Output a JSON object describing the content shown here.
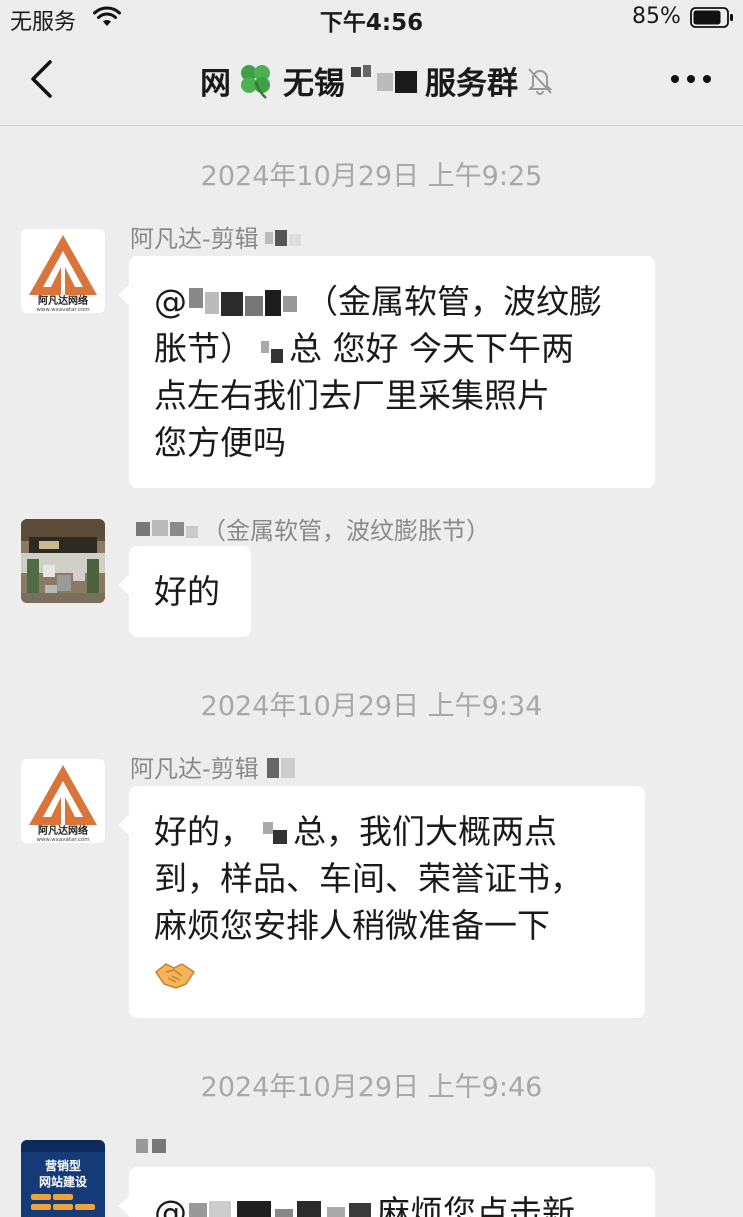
{
  "status_bar": {
    "carrier": "无服务",
    "time": "下午4:56",
    "battery": "85%",
    "icons": [
      "wifi-icon",
      "battery-icon"
    ]
  },
  "nav": {
    "back_icon": "chevron-left-icon",
    "title_prefix": "网",
    "title_emoji": "clover-icon",
    "title_mid": "无锡",
    "title_suffix": "服务群",
    "mute_icon": "bell-muted-icon",
    "more_icon": "more-dots-icon"
  },
  "colors": {
    "background": "#ededed",
    "bubble": "#ffffff",
    "timestamp": "#a8a8a8",
    "sender": "#8a8a8a",
    "avatar_brand": "#d9743a"
  },
  "messages": [
    {
      "type": "timestamp",
      "text": "2024年10月29日 上午9:25"
    },
    {
      "type": "message",
      "sender": "阿凡达-剪辑",
      "avatar": "avatar-brand-logo",
      "avatar_caption": "阿凡达网络",
      "avatar_url": "www.wxavatar.com",
      "text_lead": "@",
      "text_after_mention": "（金属软管，波纹膨",
      "text_line2": "胀节）",
      "text_line2_end": "总 您好 今天下午两",
      "text_line3": "点左右我们去厂里采集照片",
      "text_line4": "您方便吗"
    },
    {
      "type": "message",
      "sender_suffix": "（金属软管，波纹膨胀节）",
      "avatar": "avatar-photo",
      "text": "好的"
    },
    {
      "type": "timestamp",
      "text": "2024年10月29日 上午9:34"
    },
    {
      "type": "message",
      "sender": "阿凡达-剪辑",
      "avatar": "avatar-brand-logo",
      "avatar_caption": "阿凡达网络",
      "avatar_url": "www.wxavatar.com",
      "text_line1_a": "好的，",
      "text_line1_b": "总，我们大概两点",
      "text_line2": "到，样品、车间、荣誉证书，",
      "text_line3": "麻烦您安排人稍微准备一下",
      "emoji": "handshake-icon"
    },
    {
      "type": "timestamp",
      "text": "2024年10月29日 上午9:46"
    },
    {
      "type": "message",
      "avatar": "avatar-website-banner",
      "avatar_title": "营销型\n网站建设",
      "text_lead": "@",
      "text_visible": "麻烦您点击新"
    }
  ]
}
